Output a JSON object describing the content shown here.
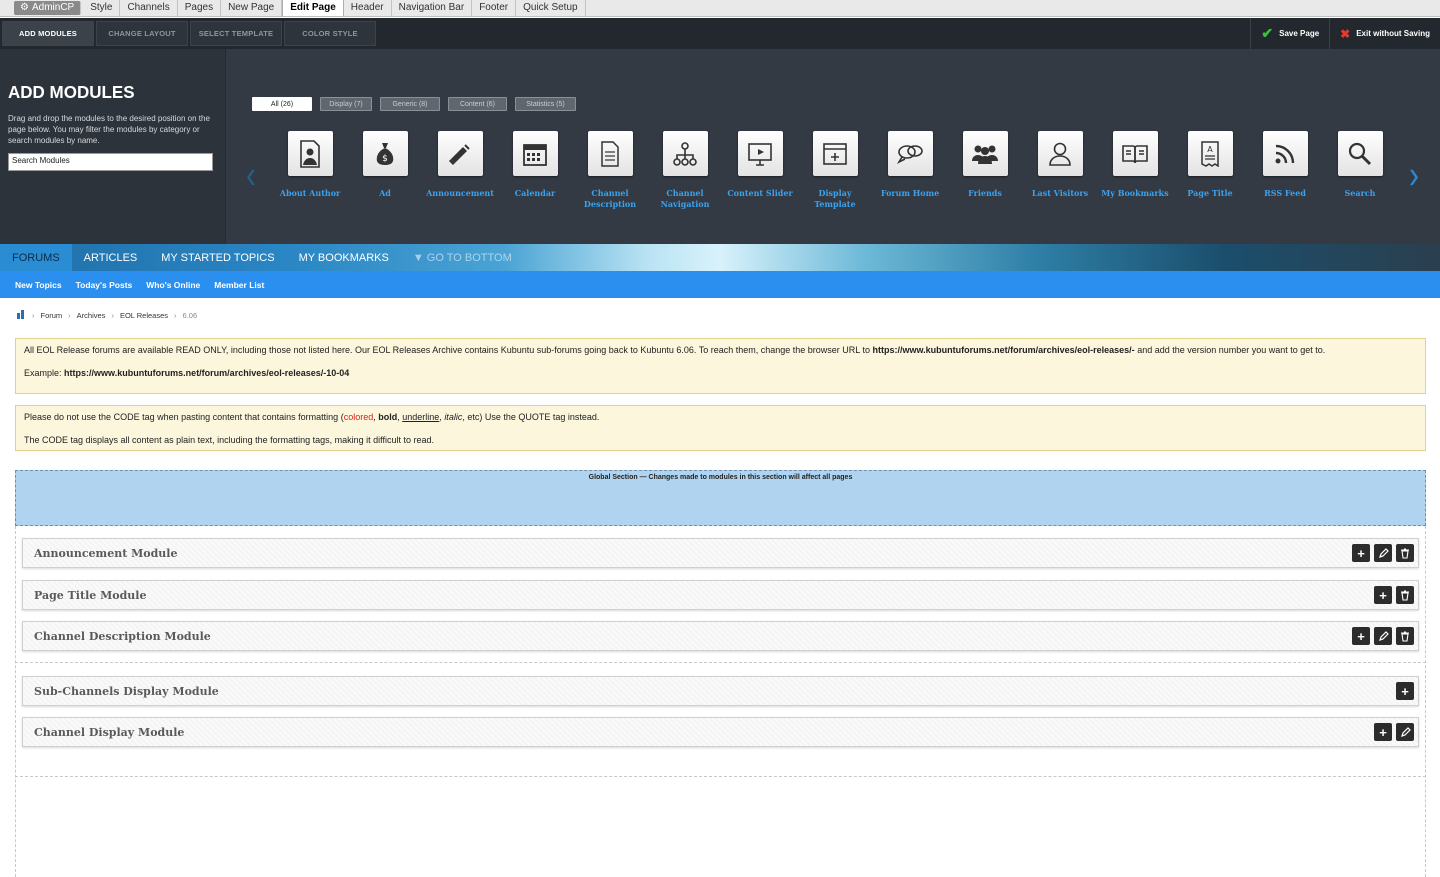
{
  "topbar": {
    "admin_label": "AdminCP",
    "tabs": [
      "Style",
      "Channels",
      "Pages",
      "New Page",
      "Edit Page",
      "Header",
      "Navigation Bar",
      "Footer",
      "Quick Setup"
    ]
  },
  "toolbar": {
    "tabs": [
      "ADD MODULES",
      "CHANGE LAYOUT",
      "SELECT TEMPLATE",
      "COLOR STYLE"
    ],
    "save_label": "Save Page",
    "exit_label": "Exit without Saving"
  },
  "module_panel": {
    "title": "ADD MODULES",
    "description": "Drag and drop the modules to the desired position on the page below. You may filter the modules by category or search modules by name.",
    "search_placeholder": "Search Modules",
    "filters": [
      "All (26)",
      "Display (7)",
      "Generic (8)",
      "Content (6)",
      "Statistics (5)"
    ],
    "modules": [
      {
        "label": "About Author",
        "icon": "person-document-icon"
      },
      {
        "label": "Ad",
        "icon": "money-bag-icon"
      },
      {
        "label": "Announcement",
        "icon": "megaphone-icon"
      },
      {
        "label": "Calendar",
        "icon": "calendar-icon"
      },
      {
        "label": "Channel Description",
        "icon": "document-icon"
      },
      {
        "label": "Channel Navigation",
        "icon": "sitemap-icon"
      },
      {
        "label": "Content Slider",
        "icon": "presentation-icon"
      },
      {
        "label": "Display Template",
        "icon": "template-icon"
      },
      {
        "label": "Forum Home",
        "icon": "chat-bubbles-icon"
      },
      {
        "label": "Friends",
        "icon": "group-icon"
      },
      {
        "label": "Last Visitors",
        "icon": "user-icon"
      },
      {
        "label": "My Bookmarks",
        "icon": "book-icon"
      },
      {
        "label": "Page Title",
        "icon": "title-document-icon"
      },
      {
        "label": "RSS Feed",
        "icon": "rss-icon"
      },
      {
        "label": "Search",
        "icon": "search-icon"
      }
    ]
  },
  "navbar": {
    "tabs": [
      "FORUMS",
      "ARTICLES",
      "MY STARTED TOPICS",
      "MY BOOKMARKS",
      "▼ GO TO BOTTOM"
    ],
    "subtabs": [
      "New Topics",
      "Today's Posts",
      "Who's Online",
      "Member List"
    ]
  },
  "breadcrumb": [
    "Forum",
    "Archives",
    "EOL Releases",
    "6.06"
  ],
  "notice1": {
    "text": "All EOL Release forums are available READ ONLY, including those not listed here. Our EOL Releases Archive contains Kubuntu sub-forums going back to Kubuntu 6.06. To reach them, change the browser URL to ",
    "url": "https://www.kubuntuforums.net/forum/archives/eol-releases/-",
    "text_after": " and add the version number you want to get to.",
    "example_label": "Example: ",
    "example_url": "https://www.kubuntuforums.net/forum/archives/eol-releases/-10-04"
  },
  "notice2": {
    "line1_a": "Please do not use the CODE tag when pasting content that contains formatting (",
    "colored": "colored",
    "comma1": ", ",
    "bold": "bold",
    "comma2": ", ",
    "underline": "underline",
    "comma3": ", ",
    "italic": "italic",
    "line1_b": ", etc) Use the QUOTE tag instead.",
    "line2": "The CODE tag displays all content as plain text, including the formatting tags, making it difficult to read."
  },
  "global_section": "Global Section — Changes made to modules in this section will affect all pages",
  "page_modules": [
    {
      "title": "Announcement Module",
      "buttons": [
        "move",
        "edit",
        "delete"
      ]
    },
    {
      "title": "Page Title Module",
      "buttons": [
        "move",
        "delete"
      ]
    },
    {
      "title": "Channel Description Module",
      "buttons": [
        "move",
        "edit",
        "delete"
      ]
    },
    {
      "title": "Sub-Channels Display Module",
      "buttons": [
        "move"
      ]
    },
    {
      "title": "Channel Display Module",
      "buttons": [
        "move",
        "edit"
      ]
    }
  ],
  "colors": {
    "toolbar_bg": "#23282e",
    "panel_bg": "#343a43",
    "module_label": "#3aa2ee",
    "subnav_bg": "#2b8ff0",
    "global_bg": "#b0d4ef",
    "notice_bg": "#fbf6dc"
  }
}
